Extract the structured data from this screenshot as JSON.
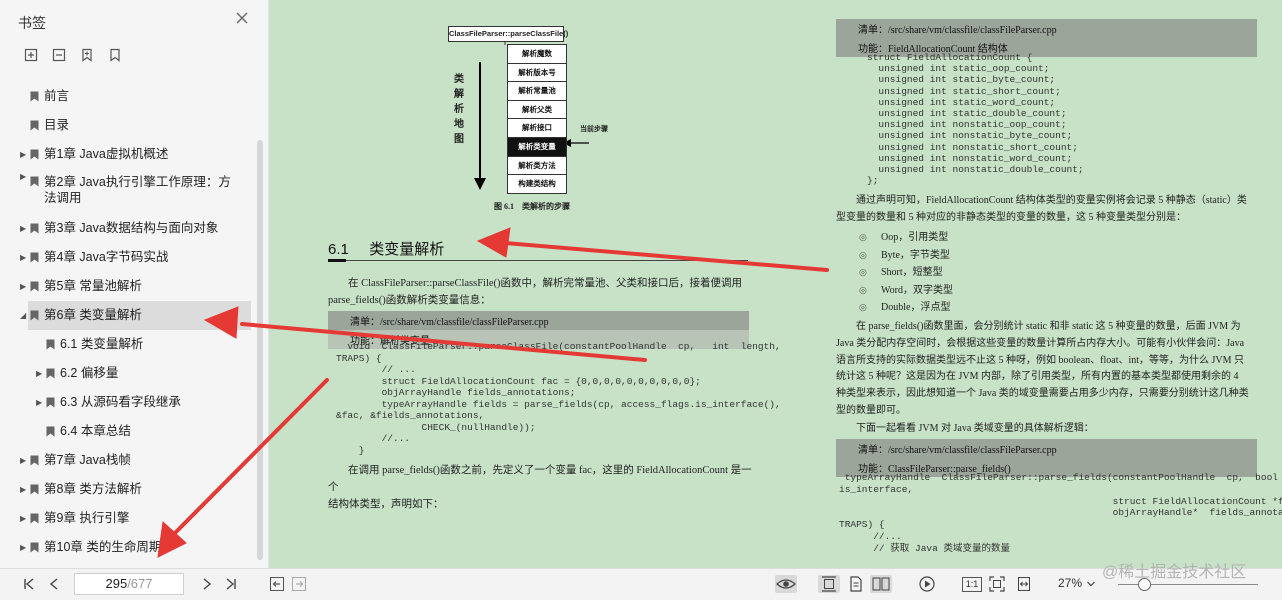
{
  "sidebar": {
    "title": "书签",
    "toc": [
      {
        "label": "前言",
        "level": 0,
        "expandable": false
      },
      {
        "label": "目录",
        "level": 0,
        "expandable": false
      },
      {
        "label": "第1章 Java虚拟机概述",
        "level": 0,
        "expandable": true
      },
      {
        "label": "第2章 Java执行引擎工作原理：方法调用",
        "level": 0,
        "expandable": true,
        "two_line": true
      },
      {
        "label": "第3章 Java数据结构与面向对象",
        "level": 0,
        "expandable": true
      },
      {
        "label": "第4章 Java字节码实战",
        "level": 0,
        "expandable": true
      },
      {
        "label": "第5章 常量池解析",
        "level": 0,
        "expandable": true
      },
      {
        "label": "第6章 类变量解析",
        "level": 0,
        "expandable": true,
        "expanded": true,
        "selected": true
      },
      {
        "label": "6.1 类变量解析",
        "level": 1,
        "expandable": false
      },
      {
        "label": "6.2 偏移量",
        "level": 1,
        "expandable": true
      },
      {
        "label": "6.3 从源码看字段继承",
        "level": 1,
        "expandable": true
      },
      {
        "label": "6.4 本章总结",
        "level": 1,
        "expandable": false
      },
      {
        "label": "第7章 Java栈帧",
        "level": 0,
        "expandable": true
      },
      {
        "label": "第8章 类方法解析",
        "level": 0,
        "expandable": true
      },
      {
        "label": "第9章 执行引擎",
        "level": 0,
        "expandable": true
      },
      {
        "label": "第10章 类的生命周期",
        "level": 0,
        "expandable": true
      }
    ]
  },
  "left_page": {
    "diagram": {
      "top_box": "ClassFileParser::parseClassFile()",
      "vertical_label": [
        "类",
        "解",
        "析",
        "地",
        "图"
      ],
      "steps": [
        "解析魔数",
        "解析版本号",
        "解析常量池",
        "解析父类",
        "解析接口",
        "解析类变量",
        "解析类方法",
        "构建类结构"
      ],
      "current_step_index": 5,
      "current_label": "当前步骤",
      "caption": "图 6.1　类解析的步骤"
    },
    "section_number": "6.1",
    "section_title": "类变量解析",
    "para1_line1": "在 ClassFileParser::parseClassFile()函数中，解析完常量池、父类和接口后，接着便调用",
    "para1_line2": "parse_fields()函数解析类变量信息：",
    "listing_title": "清单：/src/share/vm/classfile/classFileParser.cpp",
    "listing_func": "功能：解析类变量",
    "code": [
      "  void  ClassFileParser::parseClassFile(constantPoolHandle  cp,   int  length,",
      "TRAPS) {",
      "        // ...",
      "        struct FieldAllocationCount fac = {0,0,0,0,0,0,0,0,0,0};",
      "        objArrayHandle fields_annotations;",
      "        typeArrayHandle fields = parse_fields(cp, access_flags.is_interface(),",
      "&fac, &fields_annotations,",
      "               CHECK_(nullHandle));",
      "        //...",
      "    }"
    ],
    "para2_line1": "在调用 parse_fields()函数之前，先定义了一个变量 fac，这里的 FieldAllocationCount 是一个",
    "para2_line2": "结构体类型，声明如下："
  },
  "right_page": {
    "listing_title": "清单：/src/share/vm/classfile/classFileParser.cpp",
    "listing_func": "功能：FieldAllocationCount 结构体",
    "code": [
      "struct FieldAllocationCount {",
      "  unsigned int static_oop_count;",
      "  unsigned int static_byte_count;",
      "  unsigned int static_short_count;",
      "  unsigned int static_word_count;",
      "  unsigned int static_double_count;",
      "  unsigned int nonstatic_oop_count;",
      "  unsigned int nonstatic_byte_count;",
      "  unsigned int nonstatic_short_count;",
      "  unsigned int nonstatic_word_count;",
      "  unsigned int nonstatic_double_count;",
      "};"
    ],
    "para1": [
      "通过声明可知，FieldAllocationCount 结构体类型的变量实例将会记录 5 种静态（static）类",
      "型变量的数量和 5 种对应的非静态类型的变量的数量，这 5 种变量类型分别是："
    ],
    "bullets": [
      "Oop，引用类型",
      "Byte，字节类型",
      "Short，短整型",
      "Word，双字类型",
      "Double，浮点型"
    ],
    "para2": [
      "在 parse_fields()函数里面，会分别统计 static 和非 static 这 5 种变量的数量，后面 JVM 为",
      "Java 类分配内存空间时，会根据这些变量的数量计算所占内存大小。可能有小伙伴会问：Java",
      "语言所支持的实际数据类型远不止这 5 种呀，例如 boolean、float、int，等等，为什么 JVM 只",
      "统计这 5 种呢？这是因为在 JVM 内部，除了引用类型，所有内置的基本类型都使用剩余的 4",
      "种类型来表示，因此想知道一个 Java 类的域变量需要占用多少内存，只需要分别统计这几种类",
      "型的数量即可。"
    ],
    "para3": "下面一起看看 JVM 对 Java 类域变量的具体解析逻辑：",
    "listing2_title": "清单：/src/share/vm/classfile/classFileParser.cpp",
    "listing2_func": "功能：ClassFileParser::parse_fields()",
    "code2": [
      " typeArrayHandle  ClassFileParser::parse_fields(constantPoolHandle  cp,  bool",
      "is_interface,",
      "                                                struct FieldAllocationCount *fac,",
      "                                                objArrayHandle*  fields_annotations,",
      "TRAPS) {",
      "      //...",
      "      // 获取 Java 类域变量的数量"
    ]
  },
  "bottombar": {
    "current_page": "295",
    "total_pages": "/677",
    "zoom": "27%",
    "ratio_button": "1:1"
  },
  "watermark": "@稀土掘金技术社区",
  "colors": {
    "page_bg": "#c7e2c6",
    "arrow": "#e53935",
    "sidebar_bg": "#f5f5f5"
  }
}
